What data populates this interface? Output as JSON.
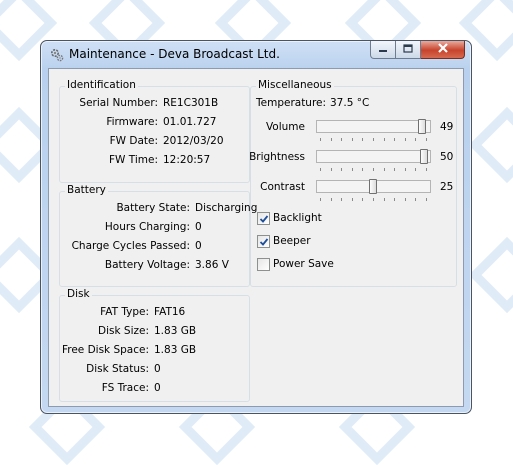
{
  "window": {
    "title": "Maintenance - Deva Broadcast Ltd.",
    "app_icon": "gear-icon",
    "buttons": [
      "minimize-icon",
      "maximize-icon",
      "close-icon"
    ]
  },
  "identification": {
    "title": "Identification",
    "fields": [
      {
        "label": "Serial Number:",
        "value": "RE1C301B"
      },
      {
        "label": "Firmware:",
        "value": "01.01.727"
      },
      {
        "label": "FW Date:",
        "value": "2012/03/20"
      },
      {
        "label": "FW Time:",
        "value": "12:20:57"
      }
    ]
  },
  "battery": {
    "title": "Battery",
    "fields": [
      {
        "label": "Battery State:",
        "value": "Discharging"
      },
      {
        "label": "Hours Charging:",
        "value": "0"
      },
      {
        "label": "Charge Cycles Passed:",
        "value": "0"
      },
      {
        "label": "Battery Voltage:",
        "value": "3.86 V"
      }
    ]
  },
  "disk": {
    "title": "Disk",
    "fields": [
      {
        "label": "FAT Type:",
        "value": "FAT16"
      },
      {
        "label": "Disk Size:",
        "value": "1.83 GB"
      },
      {
        "label": "Free Disk Space:",
        "value": "1.83 GB"
      },
      {
        "label": "Disk Status:",
        "value": "0"
      },
      {
        "label": "FS Trace:",
        "value": "0"
      }
    ]
  },
  "misc": {
    "title": "Miscellaneous",
    "temperature_label": "Temperature:",
    "temperature_value": "37.5 °C",
    "sliders": [
      {
        "label": "Volume",
        "value": "49",
        "level": 0.98
      },
      {
        "label": "Brightness",
        "value": "50",
        "level": 1.0
      },
      {
        "label": "Contrast",
        "value": "25",
        "level": 0.5
      }
    ],
    "checkboxes": [
      {
        "label": "Backlight",
        "checked": true
      },
      {
        "label": "Beeper",
        "checked": true
      },
      {
        "label": "Power Save",
        "checked": false
      }
    ]
  },
  "colors": {
    "accent": "#1e4f9c",
    "close_button": "#c8432c"
  }
}
